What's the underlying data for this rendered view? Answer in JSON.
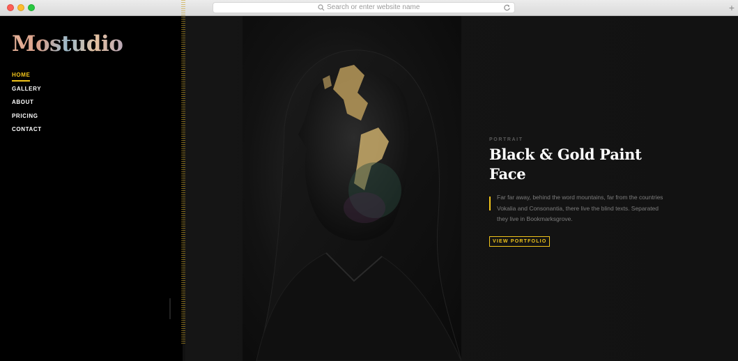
{
  "browser": {
    "url_placeholder": "Search or enter website name"
  },
  "brand": {
    "logo": "Mostudio"
  },
  "nav": {
    "items": [
      {
        "label": "HOME",
        "active": true
      },
      {
        "label": "GALLERY",
        "active": false
      },
      {
        "label": "ABOUT",
        "active": false
      },
      {
        "label": "PRICING",
        "active": false
      },
      {
        "label": "CONTACT",
        "active": false
      }
    ]
  },
  "feature": {
    "category": "PORTRAIT",
    "title_line1": "Black & Gold Paint",
    "title_line2": "Face",
    "description": "Far far away, behind the word mountains, far from the countries Vokalia and Consonantia, there live the blind texts. Separated they live in Bookmarksgrove.",
    "cta_label": "VIEW PORTFOLIO",
    "photo_icon": "hooded-man-painted-face-photo"
  },
  "colors": {
    "accent": "#f2c51b",
    "sidebar_bg": "#000000",
    "main_bg": "#141414"
  }
}
